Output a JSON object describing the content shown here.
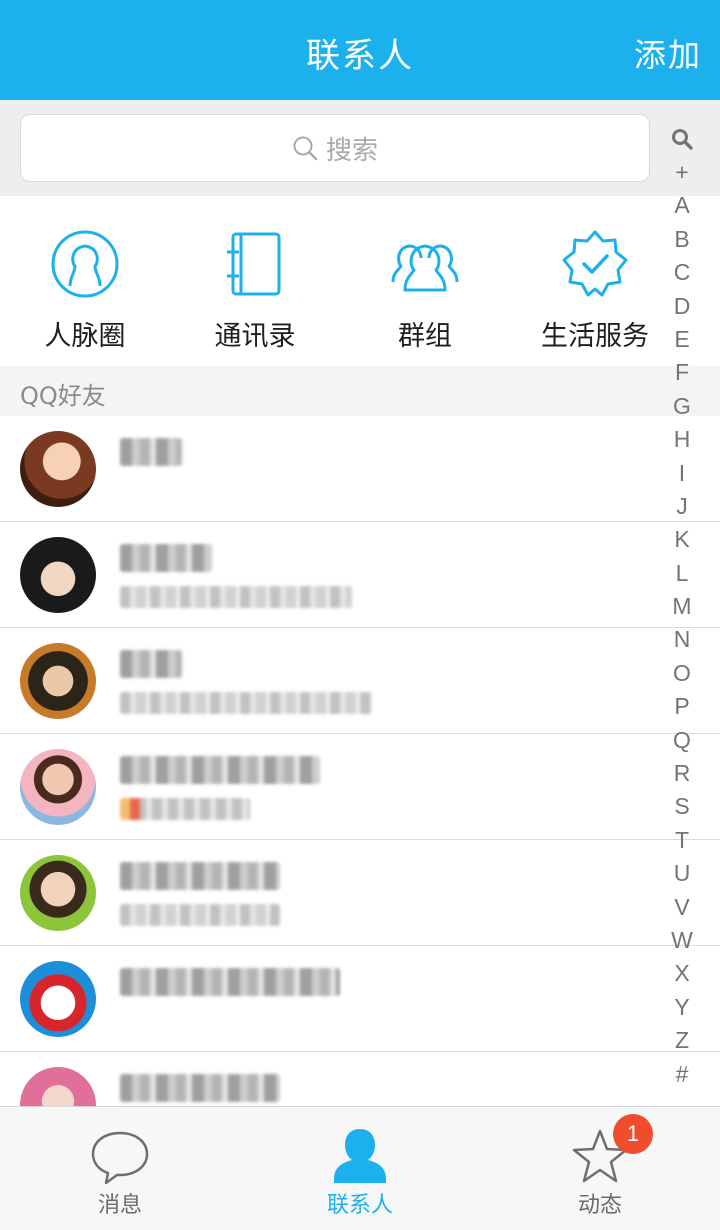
{
  "header": {
    "title": "联系人",
    "action_label": "添加"
  },
  "search": {
    "placeholder": "搜索"
  },
  "quick_entries": [
    {
      "label": "人脉圈",
      "icon": "person-circle-icon"
    },
    {
      "label": "通讯录",
      "icon": "address-book-icon"
    },
    {
      "label": "群组",
      "icon": "group-icon"
    },
    {
      "label": "生活服务",
      "icon": "verified-badge-icon"
    }
  ],
  "section_title": "QQ好友",
  "index_bar": [
    "+",
    "A",
    "B",
    "C",
    "D",
    "E",
    "F",
    "G",
    "H",
    "I",
    "J",
    "K",
    "L",
    "M",
    "N",
    "O",
    "P",
    "Q",
    "R",
    "S",
    "T",
    "U",
    "V",
    "W",
    "X",
    "Y",
    "Z",
    "#"
  ],
  "tabs": [
    {
      "label": "消息",
      "icon": "chat-bubble-icon"
    },
    {
      "label": "联系人",
      "icon": "person-icon"
    },
    {
      "label": "动态",
      "icon": "star-icon",
      "badge": "1"
    }
  ],
  "colors": {
    "accent": "#1cb0ec",
    "badge": "#f04d2f",
    "section_bg": "#f4f4f4"
  }
}
